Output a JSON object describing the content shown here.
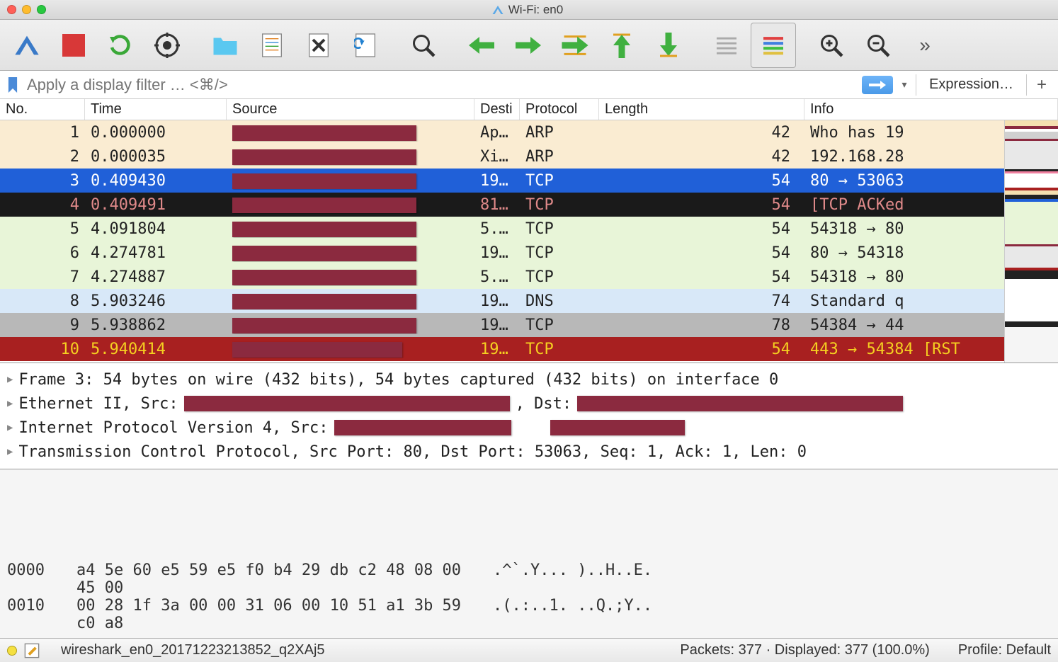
{
  "window": {
    "title": "Wi-Fi: en0"
  },
  "filter": {
    "placeholder": "Apply a display filter … <⌘/>",
    "expression": "Expression…"
  },
  "columns": {
    "no": "No.",
    "time": "Time",
    "source": "Source",
    "dest": "Desti",
    "proto": "Protocol",
    "len": "Length",
    "info": "Info"
  },
  "packets": [
    {
      "no": "1",
      "time": "0.000000",
      "dest": "Ap…",
      "proto": "ARP",
      "len": "42",
      "info": "Who has 19",
      "bg": "#faecd2",
      "fg": "#222",
      "rw": 260
    },
    {
      "no": "2",
      "time": "0.000035",
      "dest": "Xi…",
      "proto": "ARP",
      "len": "42",
      "info": "192.168.28",
      "bg": "#faecd2",
      "fg": "#222",
      "rw": 260
    },
    {
      "no": "3",
      "time": "0.409430",
      "dest": "19…",
      "proto": "TCP",
      "len": "54",
      "info": "80 → 53063",
      "bg": "#2060d8",
      "fg": "#fff",
      "rw": 260
    },
    {
      "no": "4",
      "time": "0.409491",
      "dest": "81…",
      "proto": "TCP",
      "len": "54",
      "info": "[TCP ACKed",
      "bg": "#1a1a1a",
      "fg": "#e08a8a",
      "rw": 260
    },
    {
      "no": "5",
      "time": "4.091804",
      "dest": "5.…",
      "proto": "TCP",
      "len": "54",
      "info": "54318 → 80",
      "bg": "#e8f5d8",
      "fg": "#222",
      "rw": 260
    },
    {
      "no": "6",
      "time": "4.274781",
      "dest": "19…",
      "proto": "TCP",
      "len": "54",
      "info": "80 → 54318",
      "bg": "#e8f5d8",
      "fg": "#222",
      "rw": 260
    },
    {
      "no": "7",
      "time": "4.274887",
      "dest": "5.…",
      "proto": "TCP",
      "len": "54",
      "info": "54318 → 80",
      "bg": "#e8f5d8",
      "fg": "#222",
      "rw": 260
    },
    {
      "no": "8",
      "time": "5.903246",
      "dest": "19…",
      "proto": "DNS",
      "len": "74",
      "info": "Standard q",
      "bg": "#d8e8f8",
      "fg": "#222",
      "rw": 260
    },
    {
      "no": "9",
      "time": "5.938862",
      "dest": "19…",
      "proto": "TCP",
      "len": "78",
      "info": "54384 → 44",
      "bg": "#b8b8b8",
      "fg": "#222",
      "rw": 260
    },
    {
      "no": "10",
      "time": "5.940414",
      "dest": "19…",
      "proto": "TCP",
      "len": "54",
      "info": "443 → 54384 [RST",
      "bg": "#a82020",
      "fg": "#f5d020",
      "rw": 240
    }
  ],
  "details": {
    "frame": "Frame 3: 54 bytes on wire (432 bits), 54 bytes captured (432 bits) on interface 0",
    "eth_pre": "Ethernet II, Src: ",
    "eth_mid": ", Dst: ",
    "ip_pre": "Internet Protocol Version 4, Src: ",
    "tcp": "Transmission Control Protocol, Src Port: 80, Dst Port: 53063, Seq: 1, Ack: 1, Len: 0"
  },
  "hex": [
    {
      "off": "0000",
      "bytes": "a4 5e 60 e5 59 e5 f0 b4  29 db c2 48 08 00 45 00",
      "ascii": ".^`.Y... )..H..E."
    },
    {
      "off": "0010",
      "bytes": "00 28 1f 3a 00 00 31 06  00 10 51 a1 3b 59 c0 a8",
      "ascii": ".(.:..1. ..Q.;Y.."
    }
  ],
  "status": {
    "file": "wireshark_en0_20171223213852_q2XAj5",
    "packets": "Packets: 377 · Displayed: 377 (100.0%)",
    "profile": "Profile: Default"
  }
}
